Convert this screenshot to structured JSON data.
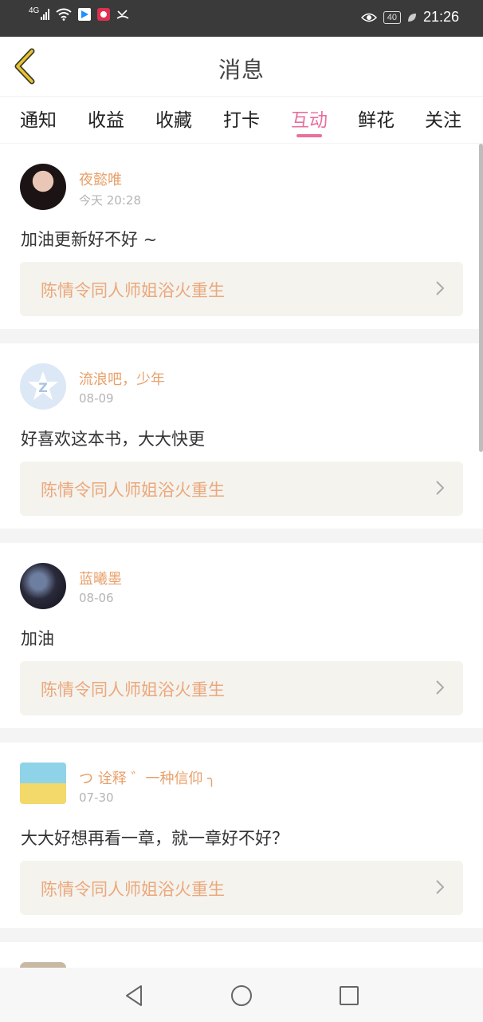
{
  "status_bar": {
    "network": "4G",
    "time": "21:26",
    "battery": "40"
  },
  "header": {
    "title": "消息"
  },
  "tabs": [
    {
      "label": "通知"
    },
    {
      "label": "收益"
    },
    {
      "label": "收藏"
    },
    {
      "label": "打卡"
    },
    {
      "label": "互动",
      "active": true
    },
    {
      "label": "鲜花"
    },
    {
      "label": "关注"
    }
  ],
  "messages": [
    {
      "user": "夜懿唯",
      "time": "今天 20:28",
      "text": "加油更新好不好 ~",
      "book": "陈情令同人师姐浴火重生"
    },
    {
      "user": "流浪吧，少年",
      "time": "08-09",
      "text": "好喜欢这本书，大大快更",
      "book": "陈情令同人师姐浴火重生"
    },
    {
      "user": "蓝曦墨",
      "time": "08-06",
      "text": "加油",
      "book": "陈情令同人师姐浴火重生"
    },
    {
      "user": "つ 诠释 ゛一种信仰 ╮",
      "time": "07-30",
      "text": "大大好想再看一章，就一章好不好？",
      "book": "陈情令同人师姐浴火重生"
    }
  ],
  "colors": {
    "accent": "#e8709c",
    "username": "#e8a06a",
    "book_title": "#eba87c",
    "status_bar": "#3a3a3a"
  }
}
